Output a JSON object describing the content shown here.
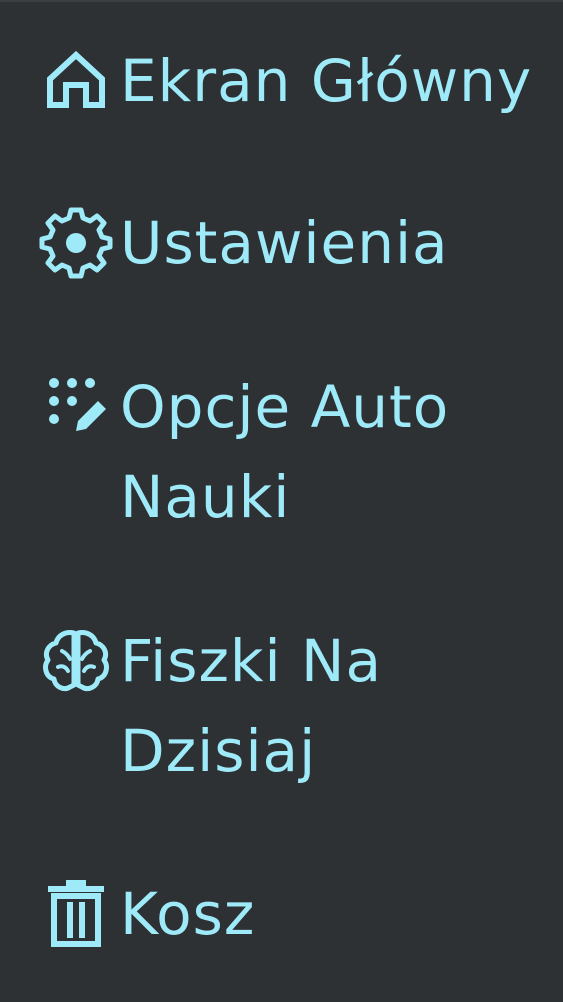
{
  "nav": {
    "accent_color": "#9eeaf9",
    "background_color": "#2d3134",
    "items": [
      {
        "label": "Ekran Główny",
        "icon": "home-icon"
      },
      {
        "label": "Ustawienia",
        "icon": "gear-icon"
      },
      {
        "label": "Opcje Auto Nauki",
        "icon": "dots-pencil-icon"
      },
      {
        "label": "Fiszki Na Dzisiaj",
        "icon": "brain-icon"
      },
      {
        "label": "Kosz",
        "icon": "trash-icon"
      }
    ]
  }
}
